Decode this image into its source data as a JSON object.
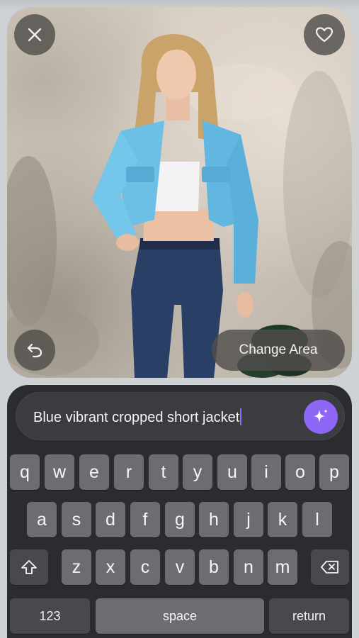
{
  "photo": {
    "close_icon": "close-icon",
    "favorite_icon": "heart-icon",
    "undo_icon": "undo-icon",
    "change_area_label": "Change Area"
  },
  "prompt": {
    "text": "Blue vibrant cropped short jacket",
    "submit_icon": "sparkle-icon",
    "submit_color": "#8e66f6"
  },
  "keyboard": {
    "row1": [
      "q",
      "w",
      "e",
      "r",
      "t",
      "y",
      "u",
      "i",
      "o",
      "p"
    ],
    "row2": [
      "a",
      "s",
      "d",
      "f",
      "g",
      "h",
      "j",
      "k",
      "l"
    ],
    "row3": [
      "z",
      "x",
      "c",
      "v",
      "b",
      "n",
      "m"
    ],
    "shift_icon": "shift-icon",
    "delete_icon": "backspace-icon",
    "numbers_label": "123",
    "space_label": "space",
    "return_label": "return"
  }
}
